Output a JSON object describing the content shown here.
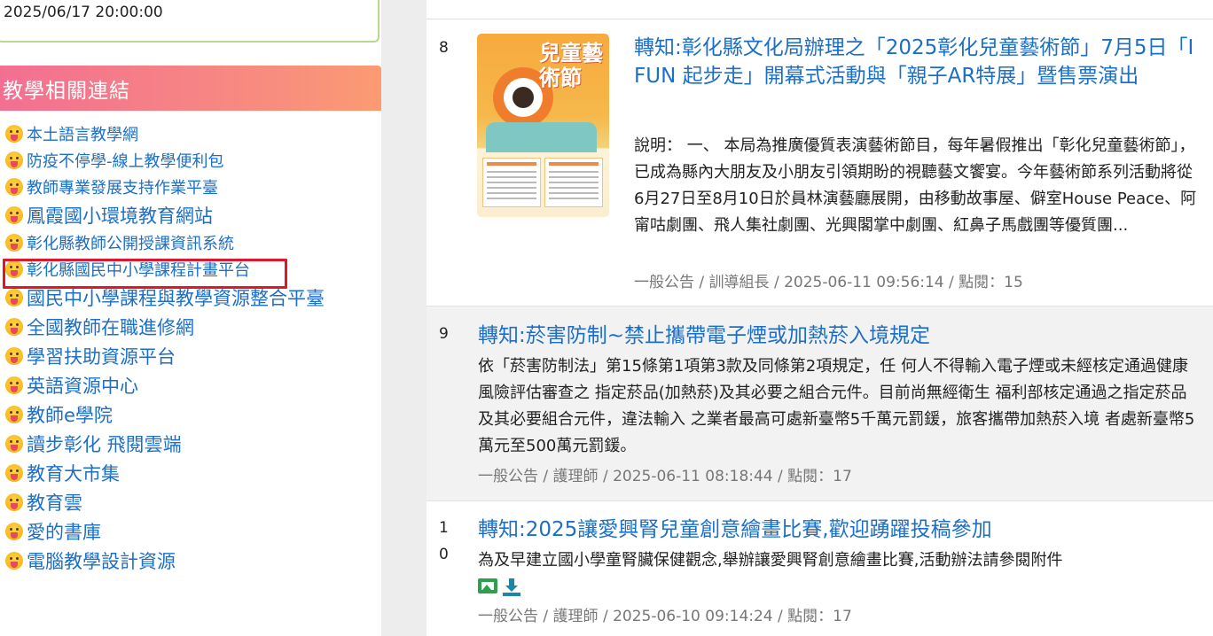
{
  "sidebar": {
    "datetime": "2025/06/17 20:00:00",
    "links_title": "教學相關連結",
    "links": [
      {
        "label": "本土語言教學網"
      },
      {
        "label": "防疫不停學-線上教學便利包"
      },
      {
        "label": "教師專業發展支持作業平臺"
      },
      {
        "label": "鳳霞國小環境教育網站"
      },
      {
        "label": "彰化縣教師公開授課資訊系統"
      },
      {
        "label": "彰化縣國民中小學課程計畫平台"
      },
      {
        "label": "國民中小學課程與教學資源整合平臺"
      },
      {
        "label": "全國教師在職進修網"
      },
      {
        "label": "學習扶助資源平台"
      },
      {
        "label": "英語資源中心"
      },
      {
        "label": "教師e學院"
      },
      {
        "label": "讀步彰化 飛閱雲端"
      },
      {
        "label": "教育大市集"
      },
      {
        "label": "教育雲"
      },
      {
        "label": "愛的書庫"
      },
      {
        "label": "電腦教學設計資源"
      }
    ],
    "highlight_color": "#e0162b"
  },
  "news": {
    "items": [
      {
        "number": "8",
        "title": "轉知:彰化縣文化局辦理之「2025彰化兒童藝術節」7月5日「I FUN 起步走」開幕式活動與「親子AR特展」暨售票演出",
        "description": "說明： 一、 本局為推廣優質表演藝術節目，每年暑假推出「彰化兒童藝術節」，已成為縣內大朋友及小朋友引領期盼的視聽藝文饗宴。今年藝術節系列活動將從6月27日至8月10日於員林演藝廳展開，由移動故事屋、僻室House Peace、阿甯咕劇團、飛人集社劇團、光興閣掌中劇團、紅鼻子馬戲團等優質團...",
        "meta": "一般公告 / 訓導組長 / 2025-06-11 09:56:14 / 點閱：15",
        "thumbnail_text": "兒童藝術節"
      },
      {
        "number": "9",
        "title": "轉知:菸害防制~禁止攜帶電子煙或加熱菸入境規定",
        "description": "依「菸害防制法」第15條第1項第3款及同條第2項規定，任 何人不得輸入電子煙或未經核定通過健康風險評估審查之 指定菸品(加熱菸)及其必要之組合元件。目前尚無經衛生 福利部核定通過之指定菸品及其必要組合元件，違法輸入 之業者最高可處新臺幣5千萬元罰鍰，旅客攜帶加熱菸入境 者處新臺幣5萬元至500萬元罰鍰。",
        "meta": "一般公告 / 護理師 / 2025-06-11 08:18:44 / 點閱：17"
      },
      {
        "number": "10",
        "title": "轉知:2025讓愛興腎兒童創意繪畫比賽,歡迎踴躍投稿參加",
        "description": "為及早建立國小學童腎臟保健觀念,舉辦讓愛興腎創意繪畫比賽,活動辦法請參閱附件",
        "meta": "一般公告 / 護理師 / 2025-06-10 09:14:24 / 點閱：17",
        "attachments": [
          "image-icon",
          "download-icon"
        ]
      }
    ]
  },
  "colors": {
    "link": "#1c6fc6",
    "header_gradient_start": "#f26f92",
    "header_gradient_end": "#fb9b72",
    "meta_gray": "#777777"
  }
}
